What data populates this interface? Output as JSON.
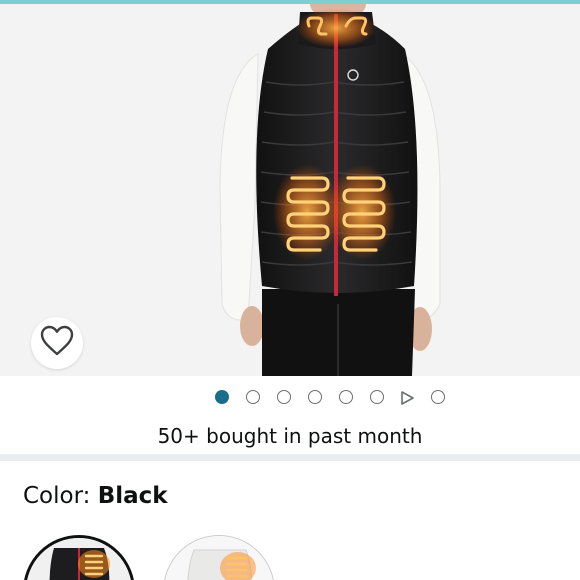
{
  "product": {
    "social_proof": "50+ bought in past month",
    "color_label": "Color:",
    "color_value": "Black",
    "carousel": {
      "total_slides": 8,
      "active_index": 0,
      "video_index": 6
    },
    "swatches": [
      {
        "name": "Black",
        "selected": true
      },
      {
        "name": "White",
        "selected": false
      }
    ]
  },
  "icons": {
    "wishlist": "heart-outline-icon",
    "video": "play-triangle-icon"
  },
  "colors": {
    "accent": "#1b6e8a",
    "top_bar": "#7ecfd1",
    "vest": "#1d1d1f",
    "zipper": "#c8283a",
    "heating": "#ff9a1f"
  }
}
